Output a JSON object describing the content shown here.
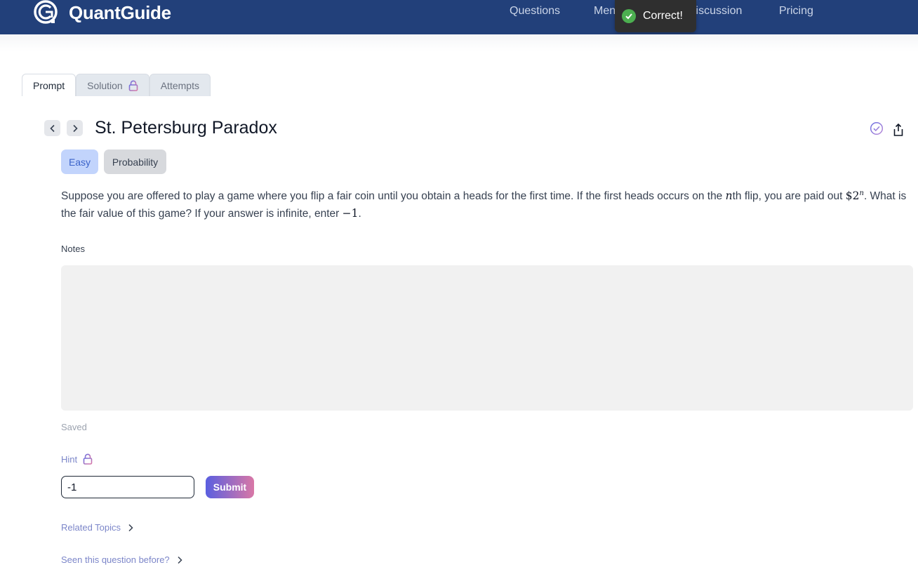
{
  "header": {
    "brand": "QuantGuide",
    "nav": [
      "Questions",
      "Men",
      "Discussion",
      "Pricing"
    ]
  },
  "toast": {
    "text": "Correct!"
  },
  "tabs": [
    {
      "label": "Prompt",
      "active": true
    },
    {
      "label": "Solution",
      "locked": true
    },
    {
      "label": "Attempts"
    }
  ],
  "question": {
    "title": "St. Petersburg Paradox",
    "difficulty": "Easy",
    "topic": "Probability",
    "prompt_a": "Suppose you are offered to play a game where you flip a fair coin until you obtain a heads for the first time. If the first heads occurs on the ",
    "prompt_var": "n",
    "prompt_b": "th flip, you are paid out ",
    "prompt_pay": "$2",
    "prompt_exp": "n",
    "prompt_c": ". What is the fair value of this game? If your answer is infinite, enter ",
    "prompt_neg": "−1",
    "prompt_d": "."
  },
  "notes": {
    "label": "Notes",
    "status": "Saved"
  },
  "hint": {
    "label": "Hint"
  },
  "answer": {
    "value": "-1"
  },
  "submit": {
    "label": "Submit"
  },
  "links": {
    "related": "Related Topics",
    "seen": "Seen this question before?"
  },
  "colors": {
    "header_bg": "#22407a",
    "toast_bg": "#2f2f2f",
    "toast_check": "#4caf50",
    "easy_badge": "#c2d4fc",
    "accent_link": "#7c86c9"
  }
}
